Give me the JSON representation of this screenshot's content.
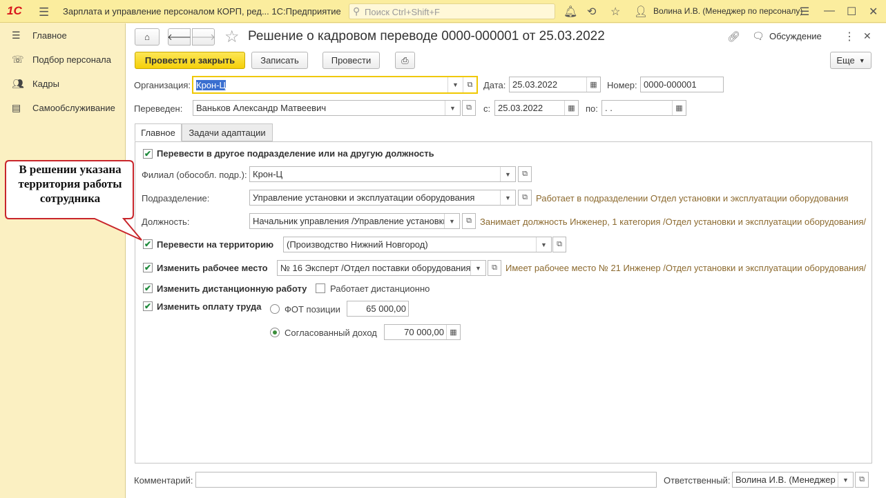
{
  "titlebar": {
    "logo": "1С",
    "app_title": "Зарплата и управление персоналом КОРП, ред...   1С:Предприятие",
    "search_placeholder": "Поиск Ctrl+Shift+F",
    "user": "Волина И.В. (Менеджер по персоналу)"
  },
  "sidebar": {
    "items": [
      {
        "label": "Главное",
        "icon": "menu-lines-icon"
      },
      {
        "label": "Подбор персонала",
        "icon": "headset-icon"
      },
      {
        "label": "Кадры",
        "icon": "people-icon"
      },
      {
        "label": "Самообслуживание",
        "icon": "id-card-icon"
      }
    ]
  },
  "form": {
    "title": "Решение о кадровом переводе 0000-000001 от 25.03.2022",
    "discussion": "Обсуждение",
    "buttons": {
      "post_close": "Провести и закрыть",
      "save": "Записать",
      "post": "Провести",
      "more": "Еще"
    },
    "organization": {
      "label": "Организация:",
      "value": "Крон-Ц"
    },
    "date": {
      "label": "Дата:",
      "value": "25.03.2022"
    },
    "number": {
      "label": "Номер:",
      "value": "0000-000001"
    },
    "employee": {
      "label": "Переведен:",
      "value": "Ваньков Александр Матвеевич"
    },
    "from": {
      "label": "с:",
      "value": "25.03.2022"
    },
    "to": {
      "label": "по:",
      "value": " .  ."
    },
    "tabs": [
      "Главное",
      "Задачи адаптации"
    ],
    "transfer_dept": {
      "label": "Перевести в другое подразделение или на другую должность",
      "checked": true
    },
    "branch": {
      "label": "Филиал (обособл. подр.):",
      "value": "Крон-Ц"
    },
    "department": {
      "label": "Подразделение:",
      "value": "Управление установки и эксплуатации оборудования",
      "hint": "Работает в подразделении Отдел установки и эксплуатации оборудования"
    },
    "position": {
      "label": "Должность:",
      "value": "Начальник управления /Управление установки и эксплуатации оборудования",
      "hint": "Занимает должность Инженер, 1 категория /Отдел установки и эксплуатации оборудования/"
    },
    "territory": {
      "label": "Перевести на территорию",
      "value": "(Производство Нижний Новгород)",
      "checked": true
    },
    "workplace": {
      "label": "Изменить рабочее место",
      "value": "№ 16 Эксперт /Отдел поставки оборудования/",
      "hint": "Имеет рабочее место № 21 Инженер /Отдел установки и эксплуатации оборудования/",
      "checked": true
    },
    "remote": {
      "label": "Изменить дистанционную работу",
      "checked": true,
      "sub_label": "Работает дистанционно",
      "sub_checked": false
    },
    "pay": {
      "label": "Изменить оплату труда",
      "checked": true
    },
    "fot": {
      "label": "ФОТ позиции",
      "value": "65 000,00"
    },
    "agreed": {
      "label": "Согласованный доход",
      "value": "70 000,00"
    },
    "comment": {
      "label": "Комментарий:",
      "value": ""
    },
    "responsible": {
      "label": "Ответственный:",
      "value": "Волина И.В. (Менеджер по персоналу)"
    }
  },
  "callout": {
    "text": "В решении указана территория работы сотрудника"
  }
}
